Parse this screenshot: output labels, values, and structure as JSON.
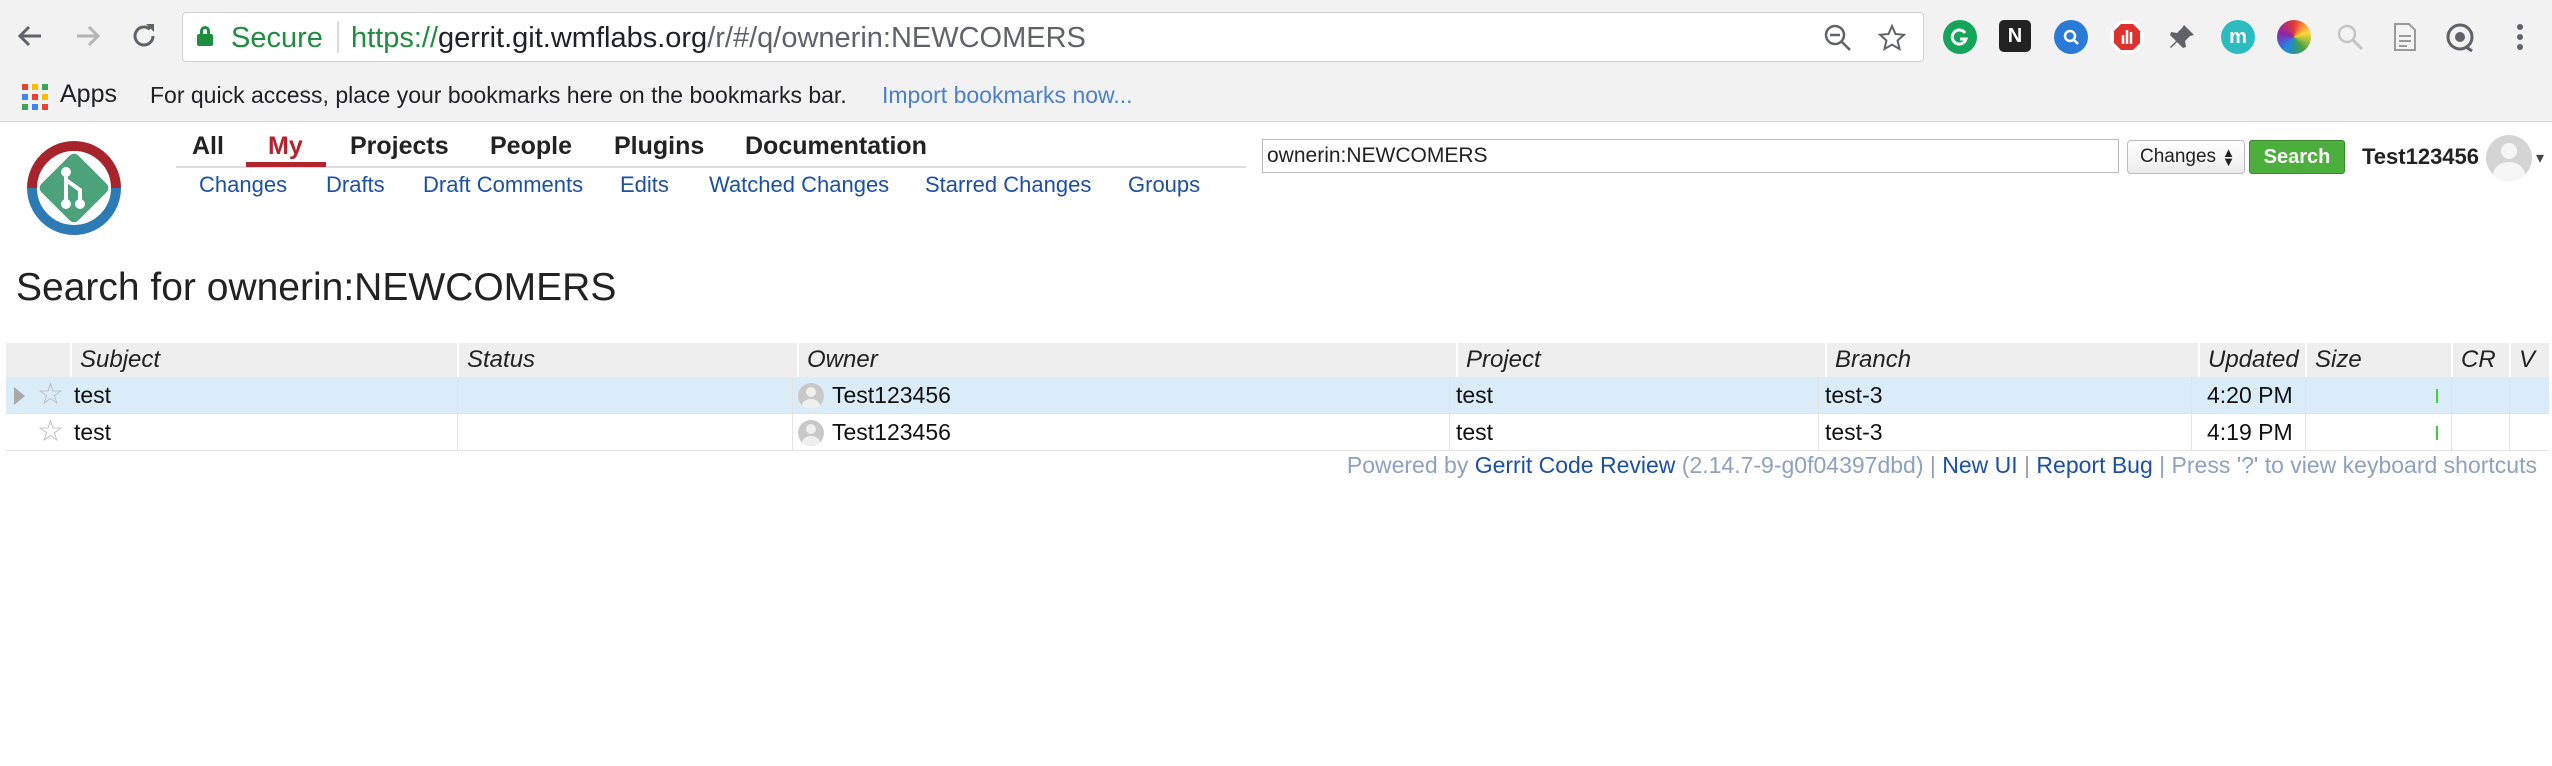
{
  "browser": {
    "secure_label": "Secure",
    "url_scheme": "https://",
    "url_host": "gerrit.git.wmflabs.org",
    "url_path": "/r/#/q/ownerin:NEWCOMERS",
    "bookmarks_apps_label": "Apps",
    "bookmarks_hint": "For quick access, place your bookmarks here on the bookmarks bar.",
    "bookmarks_import_link": "Import bookmarks now...",
    "ext_notion_letter": "N",
    "ext_m_letter": "m"
  },
  "header": {
    "top_menu": [
      "All",
      "My",
      "Projects",
      "People",
      "Plugins",
      "Documentation"
    ],
    "active_top_menu": "My",
    "sub_menu": [
      "Changes",
      "Drafts",
      "Draft Comments",
      "Edits",
      "Watched Changes",
      "Starred Changes",
      "Groups"
    ],
    "search_value": "ownerin:NEWCOMERS",
    "search_type": "Changes",
    "search_button": "Search",
    "user_name": "Test123456"
  },
  "main": {
    "title": "Search for ownerin:NEWCOMERS",
    "table": {
      "columns": [
        "Subject",
        "Status",
        "Owner",
        "Project",
        "Branch",
        "Updated",
        "Size",
        "CR",
        "V"
      ],
      "rows": [
        {
          "subject": "test",
          "status": "",
          "owner": "Test123456",
          "project": "test",
          "branch": "test-3",
          "updated": "4:20 PM",
          "cr": "",
          "v": "",
          "selected": true
        },
        {
          "subject": "test",
          "status": "",
          "owner": "Test123456",
          "project": "test",
          "branch": "test-3",
          "updated": "4:19 PM",
          "cr": "",
          "v": "",
          "selected": false
        }
      ]
    }
  },
  "footer": {
    "powered_by": "Powered by",
    "gerrit_link": "Gerrit Code Review",
    "version": "(2.14.7-9-g0f04397dbd)",
    "pipe": "|",
    "new_ui": "New UI",
    "report_bug": "Report Bug",
    "shortcuts_hint": "Press '?' to view keyboard shortcuts"
  },
  "colors": {
    "secure_green": "#1e8e3e",
    "active_tab": "#b5232f",
    "link_blue": "#1b4fa8",
    "search_button": "#4caf3d",
    "selected_row": "#d9ecf7",
    "size_bar": "#3bd13b"
  }
}
